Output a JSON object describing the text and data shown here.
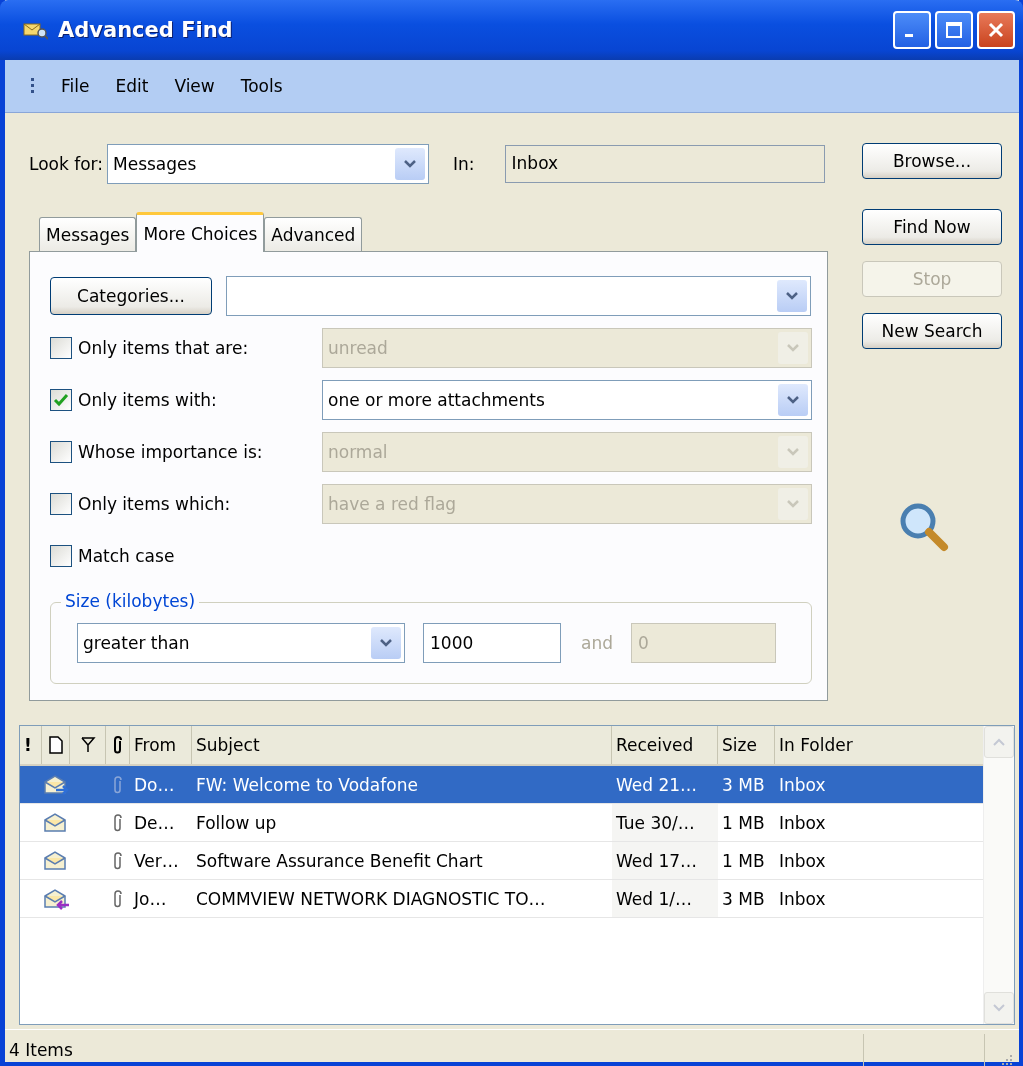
{
  "window": {
    "title": "Advanced Find"
  },
  "menu": [
    {
      "label": "File"
    },
    {
      "label": "Edit"
    },
    {
      "label": "View"
    },
    {
      "label": "Tools"
    }
  ],
  "look_for": {
    "label": "Look for:",
    "value": "Messages"
  },
  "in": {
    "label": "In:",
    "value": "Inbox"
  },
  "buttons": [
    {
      "label": "Browse...",
      "disabled": false
    },
    {
      "label": "Find Now",
      "disabled": false
    },
    {
      "label": "Stop",
      "disabled": true
    },
    {
      "label": "New Search",
      "disabled": false
    }
  ],
  "tabs": [
    {
      "label": "Messages",
      "selected": false
    },
    {
      "label": "More Choices",
      "selected": true
    },
    {
      "label": "Advanced",
      "selected": false
    }
  ],
  "categories": {
    "label": "Categories..."
  },
  "options": [
    {
      "kind": "checkbox-select",
      "label": "Only items that are:",
      "checked": false,
      "value": "unread",
      "disabled": true
    },
    {
      "kind": "checkbox-select",
      "label": "Only items with:",
      "checked": true,
      "value": "one or more attachments",
      "disabled": false
    },
    {
      "kind": "checkbox-select",
      "label": "Whose importance is:",
      "checked": false,
      "value": "normal",
      "disabled": true
    },
    {
      "kind": "checkbox-select",
      "label": "Only items which:",
      "checked": false,
      "value": "have a red flag",
      "disabled": true
    },
    {
      "kind": "checkbox",
      "label": "Match case",
      "checked": false
    }
  ],
  "size": {
    "legend": "Size (kilobytes)",
    "condition": "greater than",
    "value": "1000",
    "and_label": "and",
    "value_2": "0"
  },
  "columns": {
    "importance": "!",
    "from": "From",
    "subject": "Subject",
    "received": "Received",
    "size": "Size",
    "folder": "In Folder"
  },
  "rows": [
    {
      "kind": "forwarded",
      "attachment": true,
      "from": "Do…",
      "subject": "FW: Welcome to Vodafone",
      "received": "Wed 21…",
      "size": "3 MB",
      "folder": "Inbox",
      "selected": true
    },
    {
      "kind": "read",
      "attachment": true,
      "from": "De…",
      "subject": "Follow up",
      "received": "Tue 30/…",
      "size": "1 MB",
      "folder": "Inbox",
      "selected": false
    },
    {
      "kind": "read",
      "attachment": true,
      "from": "Ver…",
      "subject": "Software Assurance Benefit Chart",
      "received": "Wed 17…",
      "size": "1 MB",
      "folder": "Inbox",
      "selected": false
    },
    {
      "kind": "replied",
      "attachment": true,
      "from": "Jo…",
      "subject": "COMMVIEW NETWORK DIAGNOSTIC TO…",
      "received": "Wed 1/…",
      "size": "3 MB",
      "folder": "Inbox",
      "selected": false
    }
  ],
  "status_bar": {
    "text": "4 Items"
  }
}
